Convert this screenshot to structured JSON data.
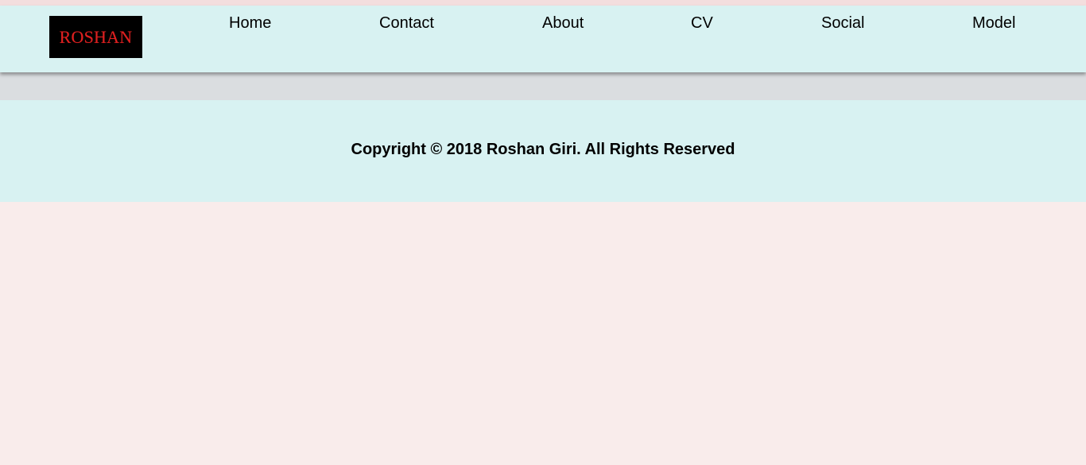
{
  "logo": {
    "text": "ROSHAN"
  },
  "nav": {
    "items": [
      {
        "label": "Home"
      },
      {
        "label": "Contact"
      },
      {
        "label": "About"
      },
      {
        "label": "CV"
      },
      {
        "label": "Social"
      },
      {
        "label": "Model"
      }
    ]
  },
  "footer": {
    "copyright": "Copyright © 2018 Roshan Giri. All Rights Reserved"
  },
  "colors": {
    "header_background": "#d8f2f2",
    "band_background": "#dadde0",
    "page_background": "#f9eceb",
    "logo_background": "#000000",
    "logo_text": "#e02020"
  }
}
